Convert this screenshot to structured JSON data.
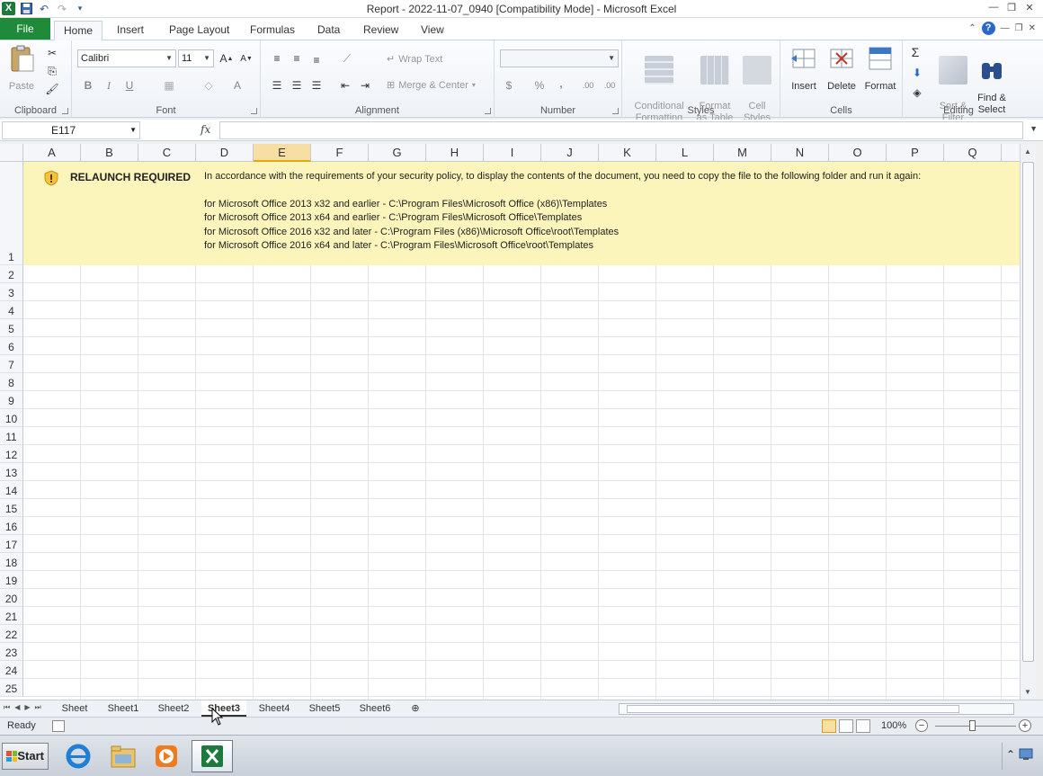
{
  "window": {
    "title": "Report - 2022-11-07_0940  [Compatibility Mode]  -  Microsoft Excel",
    "app_icon": "excel-icon",
    "quick_access": [
      "save-icon",
      "undo-icon",
      "redo-icon",
      "customize-icon"
    ]
  },
  "ribbon": {
    "tabs": [
      "File",
      "Home",
      "Insert",
      "Page Layout",
      "Formulas",
      "Data",
      "Review",
      "View"
    ],
    "active_tab": "Home",
    "groups": {
      "clipboard": {
        "label": "Clipboard",
        "paste": "Paste"
      },
      "font": {
        "label": "Font",
        "font_name": "Calibri",
        "font_size": "11",
        "bold": "B",
        "italic": "I",
        "underline": "U"
      },
      "alignment": {
        "label": "Alignment",
        "wrap_text": "Wrap Text",
        "merge_center": "Merge & Center"
      },
      "number": {
        "label": "Number",
        "currency": "$",
        "percent": "%",
        "comma": ",",
        "inc_decimal": ".00",
        "dec_decimal": ".00"
      },
      "styles": {
        "label": "Styles",
        "conditional_formatting": "Conditional\nFormatting",
        "format_table": "Format\nas Table",
        "cell_styles": "Cell\nStyles"
      },
      "cells": {
        "label": "Cells",
        "insert": "Insert",
        "delete": "Delete",
        "format": "Format"
      },
      "editing": {
        "label": "Editing",
        "sort_filter": "Sort &\nFilter",
        "find_select": "Find &\nSelect",
        "sigma": "Σ"
      }
    }
  },
  "formula_bar": {
    "name_box": "E117",
    "fx": "fx",
    "formula": ""
  },
  "grid": {
    "columns": [
      "A",
      "B",
      "C",
      "D",
      "E",
      "F",
      "G",
      "H",
      "I",
      "J",
      "K",
      "L",
      "M",
      "N",
      "O",
      "P",
      "Q"
    ],
    "selected_column": "E",
    "rows": [
      "1",
      "2",
      "3",
      "4",
      "5",
      "6",
      "7",
      "8",
      "9",
      "10",
      "11",
      "12",
      "13",
      "14",
      "15",
      "16",
      "17",
      "18",
      "19",
      "20",
      "21",
      "22",
      "23",
      "24",
      "25"
    ]
  },
  "banner": {
    "icon": "warning-shield-icon",
    "title": "RELAUNCH REQUIRED",
    "message": "In accordance with the requirements of your security policy, to display the contents of the document, you need to copy the file to the following folder and run it again:",
    "lines": [
      "for Microsoft Office 2013 x32 and earlier - C:\\Program Files\\Microsoft Office (x86)\\Templates",
      "for Microsoft Office 2013 x64 and earlier - C:\\Program Files\\Microsoft Office\\Templates",
      "for Microsoft Office 2016 x32 and later - C:\\Program Files (x86)\\Microsoft Office\\root\\Templates",
      "for Microsoft Office 2016 x64 and later - C:\\Program Files\\Microsoft Office\\root\\Templates"
    ],
    "background": "#fbf5bb"
  },
  "sheets": {
    "tabs": [
      "Sheet",
      "Sheet1",
      "Sheet2",
      "Sheet3",
      "Sheet4",
      "Sheet5",
      "Sheet6"
    ],
    "active": "Sheet3"
  },
  "status": {
    "text": "Ready",
    "zoom": "100%"
  },
  "taskbar": {
    "start": "Start",
    "apps": [
      "internet-explorer-icon",
      "file-explorer-icon",
      "media-player-icon",
      "excel-icon"
    ],
    "active_app": "excel-icon"
  },
  "colors": {
    "accent": "#1f8b3a",
    "selected_header": "#f7dea3",
    "banner": "#fbf5bb"
  }
}
